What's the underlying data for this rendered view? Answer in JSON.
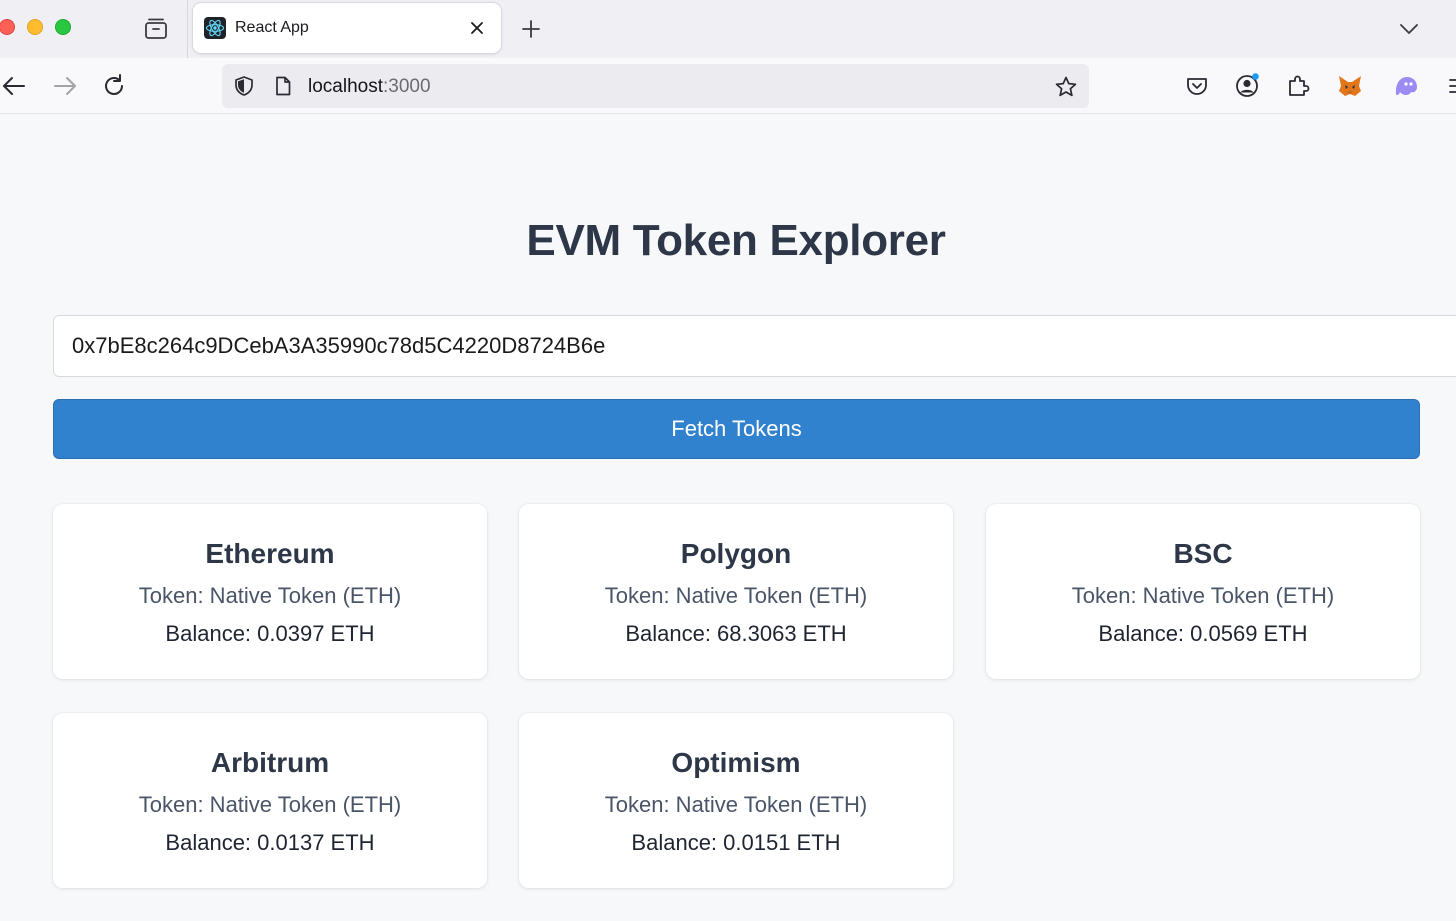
{
  "browser": {
    "tab": {
      "title": "React App"
    },
    "url": {
      "host": "localhost",
      "port": ":3000"
    },
    "colors": {
      "close_red": "#fe5f57",
      "minimize_yellow": "#febc2e",
      "zoom_green": "#28c840"
    }
  },
  "page": {
    "title": "EVM Token Explorer",
    "address_value": "0x7bE8c264c9DCebA3A35990c78d5C4220D8724B6e",
    "fetch_label": "Fetch Tokens",
    "accent_color": "#3182ce"
  },
  "cards": [
    {
      "network": "Ethereum",
      "token": "Token: Native Token (ETH)",
      "balance": "Balance: 0.0397 ETH"
    },
    {
      "network": "Polygon",
      "token": "Token: Native Token (ETH)",
      "balance": "Balance: 68.3063 ETH"
    },
    {
      "network": "BSC",
      "token": "Token: Native Token (ETH)",
      "balance": "Balance: 0.0569 ETH"
    },
    {
      "network": "Arbitrum",
      "token": "Token: Native Token (ETH)",
      "balance": "Balance: 0.0137 ETH"
    },
    {
      "network": "Optimism",
      "token": "Token: Native Token (ETH)",
      "balance": "Balance: 0.0151 ETH"
    }
  ],
  "icons": {
    "tab_favicon": "react-logo-icon",
    "toolbar": [
      "pocket-icon",
      "account-icon",
      "extensions-icon",
      "metamask-fox-icon",
      "ghost-extension-icon",
      "menu-icon"
    ]
  }
}
